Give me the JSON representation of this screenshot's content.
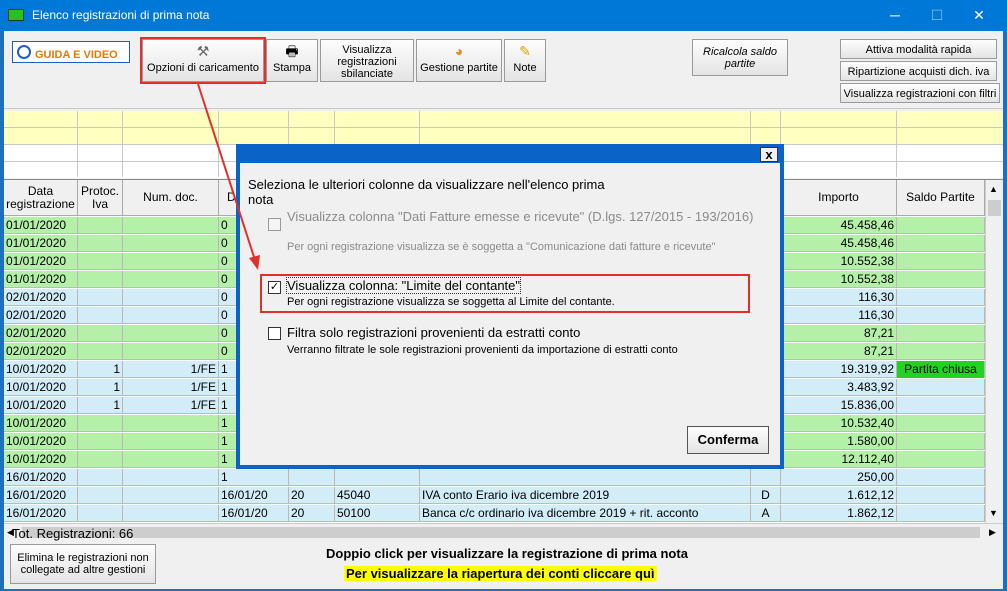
{
  "window": {
    "title": "Elenco registrazioni di prima nota",
    "minimize": "─",
    "maximize": "☐",
    "close": "✕"
  },
  "toolbar": {
    "guida": "GUIDA E VIDEO",
    "opzioni": "Opzioni di caricamento",
    "stampa": "Stampa",
    "visualizza_sbilanciate": "Visualizza registrazioni sbilanciate",
    "gestione_partite": "Gestione partite",
    "note": "Note",
    "ricalcola": "Ricalcola saldo partite",
    "attiva_rapida": "Attiva modalità rapida",
    "ripartizione": "Ripartizione acquisti dich. iva",
    "visualizza_filtri": "Visualizza registrazioni con filtri"
  },
  "grid": {
    "headers": [
      "Data registrazione",
      "Protoc. Iva",
      "Num. doc.",
      "D",
      "Importo",
      "Saldo Partite"
    ],
    "rows": [
      {
        "date": "01/01/2020",
        "prot": "",
        "num": "",
        "d": "0",
        "c5": "",
        "c6": "",
        "desc": "",
        "dc": "",
        "imp": "45.458,46",
        "saldo": "",
        "color": "#b4f0a8"
      },
      {
        "date": "01/01/2020",
        "prot": "",
        "num": "",
        "d": "0",
        "c5": "",
        "c6": "",
        "desc": "",
        "dc": "",
        "imp": "45.458,46",
        "saldo": "",
        "color": "#b4f0a8"
      },
      {
        "date": "01/01/2020",
        "prot": "",
        "num": "",
        "d": "0",
        "c5": "",
        "c6": "",
        "desc": "",
        "dc": "",
        "imp": "10.552,38",
        "saldo": "",
        "color": "#b4f0a8"
      },
      {
        "date": "01/01/2020",
        "prot": "",
        "num": "",
        "d": "0",
        "c5": "",
        "c6": "",
        "desc": "",
        "dc": "",
        "imp": "10.552,38",
        "saldo": "",
        "color": "#b4f0a8"
      },
      {
        "date": "02/01/2020",
        "prot": "",
        "num": "",
        "d": "0",
        "c5": "",
        "c6": "",
        "desc": "",
        "dc": "",
        "imp": "116,30",
        "saldo": "",
        "color": "#d2ecf8"
      },
      {
        "date": "02/01/2020",
        "prot": "",
        "num": "",
        "d": "0",
        "c5": "",
        "c6": "",
        "desc": "",
        "dc": "",
        "imp": "116,30",
        "saldo": "",
        "color": "#d2ecf8"
      },
      {
        "date": "02/01/2020",
        "prot": "",
        "num": "",
        "d": "0",
        "c5": "",
        "c6": "",
        "desc": "",
        "dc": "",
        "imp": "87,21",
        "saldo": "",
        "color": "#b4f0a8"
      },
      {
        "date": "02/01/2020",
        "prot": "",
        "num": "",
        "d": "0",
        "c5": "",
        "c6": "",
        "desc": "",
        "dc": "",
        "imp": "87,21",
        "saldo": "",
        "color": "#b4f0a8"
      },
      {
        "date": "10/01/2020",
        "prot": "1",
        "num": "1/FE",
        "d": "1",
        "c5": "",
        "c6": "",
        "desc": "",
        "dc": "",
        "imp": "19.319,92",
        "saldo": "Partita chiusa",
        "color": "#d2ecf8"
      },
      {
        "date": "10/01/2020",
        "prot": "1",
        "num": "1/FE",
        "d": "1",
        "c5": "",
        "c6": "",
        "desc": "",
        "dc": "",
        "imp": "3.483,92",
        "saldo": "",
        "color": "#d2ecf8"
      },
      {
        "date": "10/01/2020",
        "prot": "1",
        "num": "1/FE",
        "d": "1",
        "c5": "",
        "c6": "",
        "desc": "",
        "dc": "",
        "imp": "15.836,00",
        "saldo": "",
        "color": "#d2ecf8"
      },
      {
        "date": "10/01/2020",
        "prot": "",
        "num": "",
        "d": "1",
        "c5": "",
        "c6": "",
        "desc": "",
        "dc": "",
        "imp": "10.532,40",
        "saldo": "",
        "color": "#b4f0a8"
      },
      {
        "date": "10/01/2020",
        "prot": "",
        "num": "",
        "d": "1",
        "c5": "",
        "c6": "",
        "desc": "",
        "dc": "",
        "imp": "1.580,00",
        "saldo": "",
        "color": "#b4f0a8"
      },
      {
        "date": "10/01/2020",
        "prot": "",
        "num": "",
        "d": "1",
        "c5": "",
        "c6": "",
        "desc": "",
        "dc": "",
        "imp": "12.112,40",
        "saldo": "",
        "color": "#b4f0a8"
      },
      {
        "date": "16/01/2020",
        "prot": "",
        "num": "",
        "d": "1",
        "c5": "",
        "c6": "",
        "desc": "",
        "dc": "",
        "imp": "250,00",
        "saldo": "",
        "color": "#d2ecf8"
      },
      {
        "date": "16/01/2020",
        "prot": "",
        "num": "",
        "d": "16/01/20",
        "c5": "20",
        "c6": "45040",
        "desc": "IVA conto Erario iva dicembre 2019",
        "dc": "D",
        "imp": "1.612,12",
        "saldo": "",
        "color": "#d2ecf8"
      },
      {
        "date": "16/01/2020",
        "prot": "",
        "num": "",
        "d": "16/01/20",
        "c5": "20",
        "c6": "50100",
        "desc": "Banca c/c ordinario iva dicembre 2019 + rit. acconto",
        "dc": "A",
        "imp": "1.862,12",
        "saldo": "",
        "color": "#d2ecf8"
      }
    ]
  },
  "dialog": {
    "close": "x",
    "intro": "Seleziona le ulteriori colonne da visualizzare nell'elenco prima nota",
    "opt1_label": "Visualizza colonna \"Dati Fatture emesse e ricevute\" (D.lgs. 127/2015 - 193/2016)",
    "opt1_desc": "Per ogni registrazione visualizza se è soggetta a \"Comunicazione dati fatture e ricevute\"",
    "opt2_label": "Visualizza colonna: \"Limite del contante\"",
    "opt2_desc": "Per ogni registrazione visualizza se soggetta al Limite del contante.",
    "opt3_label": "Filtra solo registrazioni provenienti da estratti conto",
    "opt3_desc": "Verranno filtrate le sole registrazioni provenienti da importazione di estratti conto",
    "opt2_check": "✓",
    "confirm": "Conferma"
  },
  "footer": {
    "tot": "Tot. Registrazioni: 66",
    "elimina": "Elimina le registrazioni non collegate ad altre gestioni",
    "doppio": "Doppio click per visualizzare la registrazione di prima nota",
    "riapertura": "Per visualizzare la riapertura dei conti cliccare quì"
  },
  "colors": {
    "titlebar": "#0078d7",
    "highlight": "#e0302b",
    "dialog_border": "#0a64c8",
    "partita_chiusa": "#22d222"
  }
}
